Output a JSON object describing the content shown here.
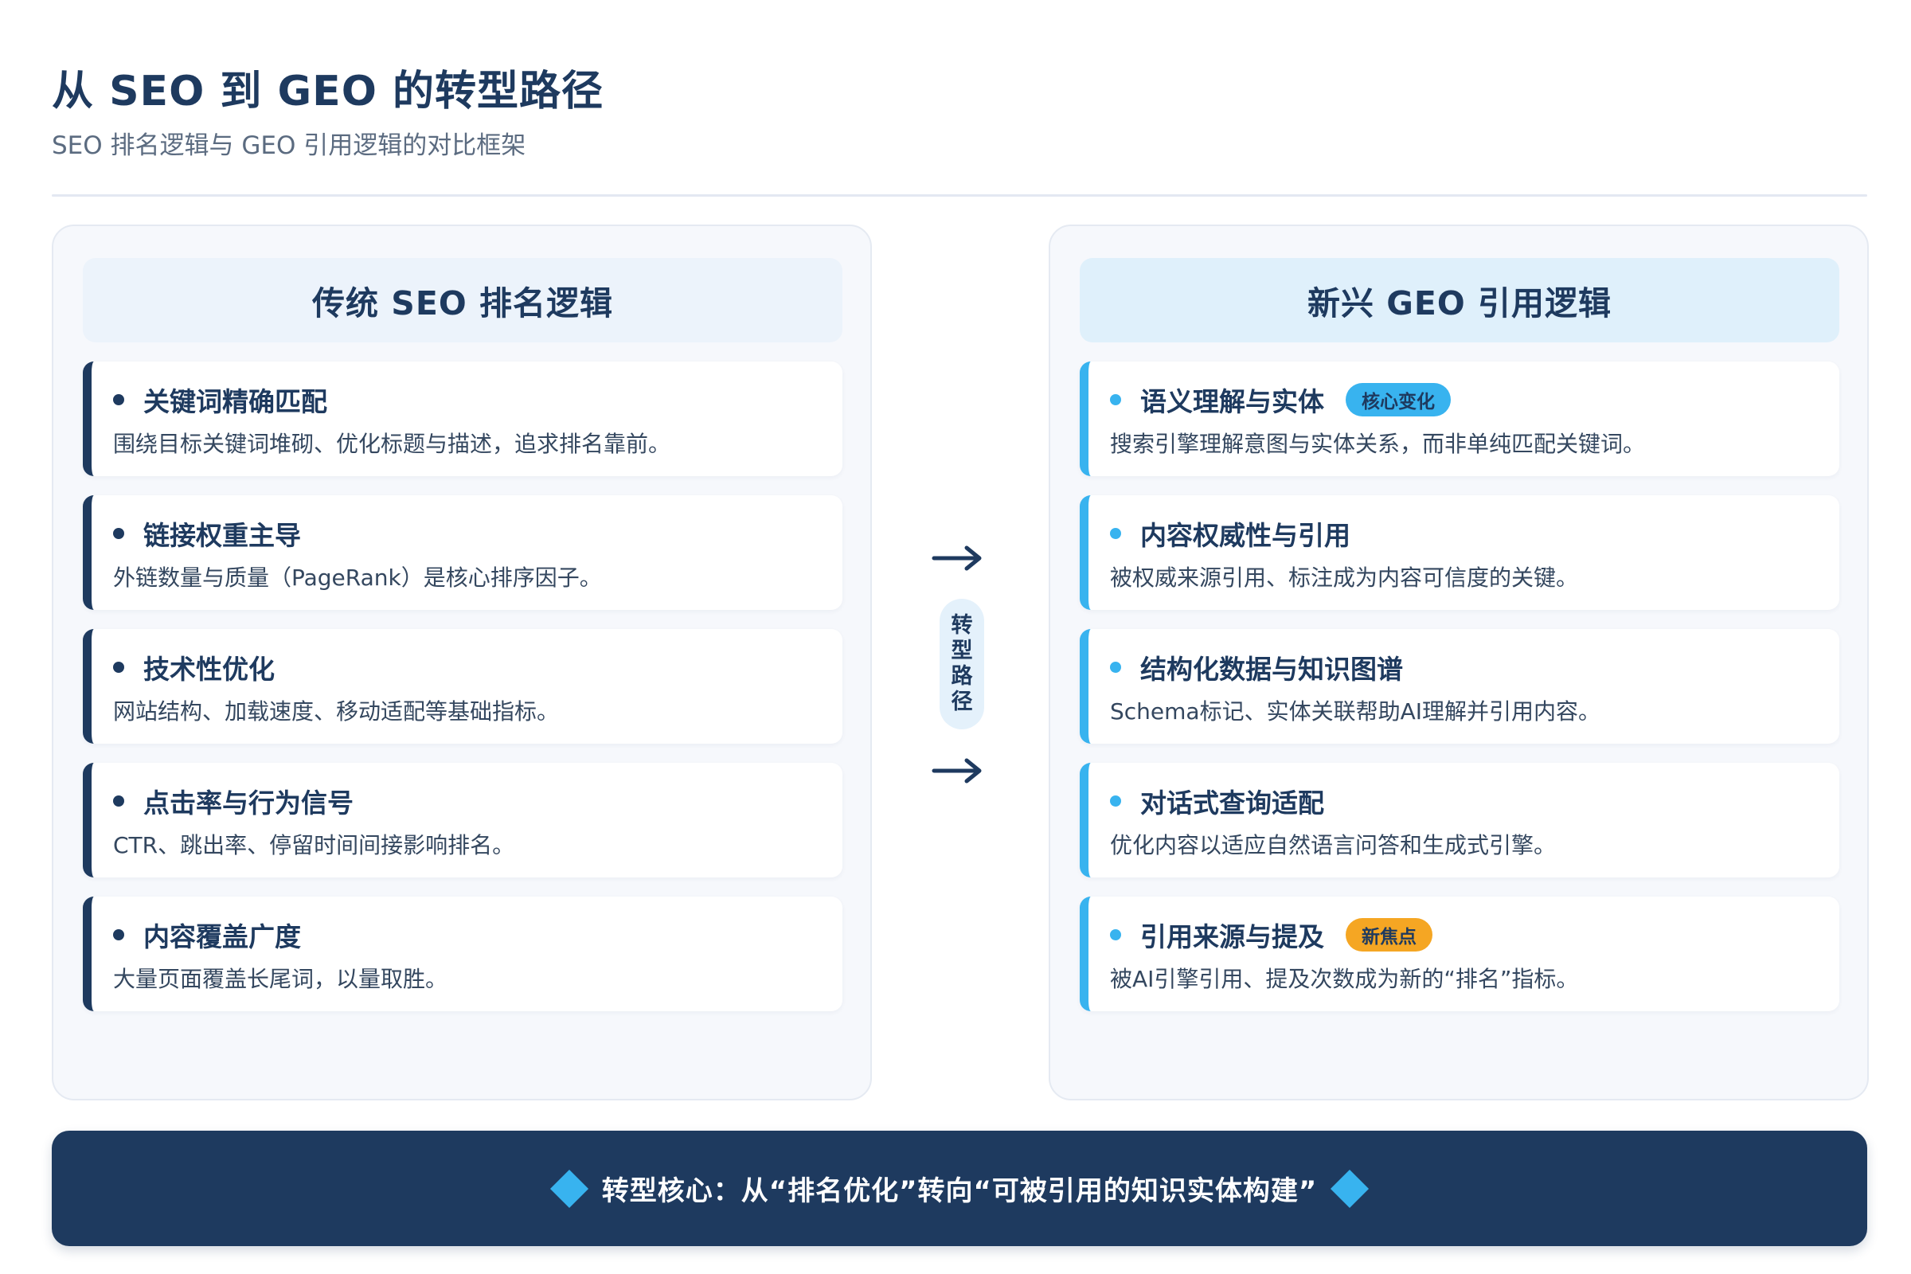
{
  "header": {
    "title": "从 SEO 到 GEO 的转型路径",
    "subtitle": "SEO 排名逻辑与 GEO 引用逻辑的对比框架"
  },
  "left": {
    "title": "传统 SEO 排名逻辑",
    "items": [
      {
        "title": "关键词精确匹配",
        "desc": "围绕目标关键词堆砌、优化标题与描述，追求排名靠前。"
      },
      {
        "title": "链接权重主导",
        "desc": "外链数量与质量（PageRank）是核心排序因子。"
      },
      {
        "title": "技术性优化",
        "desc": "网站结构、加载速度、移动适配等基础指标。"
      },
      {
        "title": "点击率与行为信号",
        "desc": "CTR、跳出率、停留时间间接影响排名。"
      },
      {
        "title": "内容覆盖广度",
        "desc": "大量页面覆盖长尾词，以量取胜。"
      }
    ]
  },
  "right": {
    "title": "新兴 GEO 引用逻辑",
    "items": [
      {
        "title": "语义理解与实体",
        "badge": "核心变化",
        "desc": "搜索引擎理解意图与实体关系，而非单纯匹配关键词。"
      },
      {
        "title": "内容权威性与引用",
        "badge": "",
        "desc": "被权威来源引用、标注成为内容可信度的关键。"
      },
      {
        "title": "结构化数据与知识图谱",
        "badge": "",
        "desc": "Schema标记、实体关联帮助AI理解并引用内容。"
      },
      {
        "title": "对话式查询适配",
        "badge": "",
        "desc": "优化内容以适应自然语言问答和生成式引擎。"
      },
      {
        "title": "引用来源与提及",
        "badge": "新焦点",
        "desc": "被AI引擎引用、提及次数成为新的“排名”指标。"
      }
    ]
  },
  "middle": {
    "label": [
      "转",
      "型",
      "路",
      "径"
    ]
  },
  "banner": {
    "text": "转型核心：从“排名优化”转向“可被引用的知识实体构建”"
  },
  "colors": {
    "navy": "#1e3a5f",
    "accent_blue": "#38b3ef",
    "accent_orange": "#f5a623"
  }
}
